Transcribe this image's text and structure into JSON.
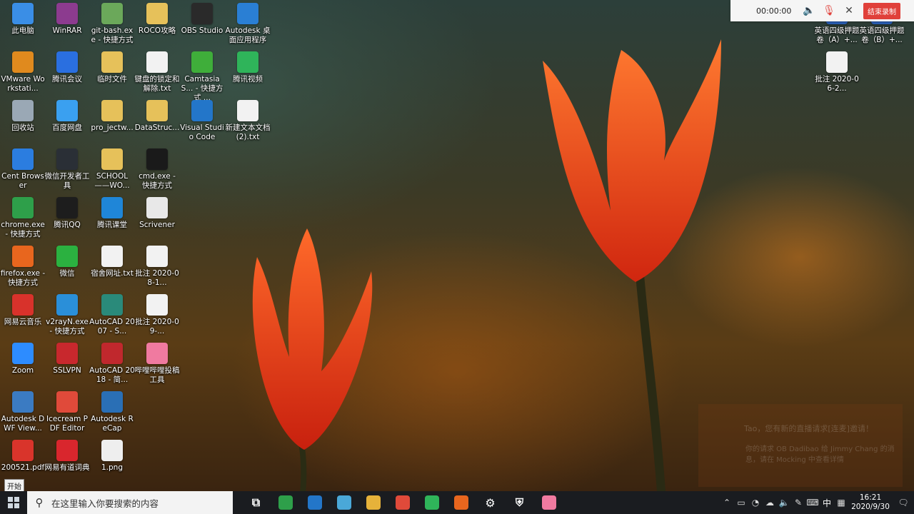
{
  "desktop_icons": [
    {
      "label": "此电脑",
      "icon": "this-pc-icon",
      "color": "#3a8ee6"
    },
    {
      "label": "VMware Workstati...",
      "icon": "vmware-icon",
      "color": "#e08a1e"
    },
    {
      "label": "回收站",
      "icon": "recycle-bin-icon",
      "color": "#9aa8b5"
    },
    {
      "label": "Cent Browser",
      "icon": "cent-browser-icon",
      "color": "#2b7de0"
    },
    {
      "label": "chrome.exe - 快捷方式",
      "icon": "chrome-icon",
      "color": "#2e9f4a"
    },
    {
      "label": "firefox.exe - 快捷方式",
      "icon": "firefox-icon",
      "color": "#e8661e"
    },
    {
      "label": "网易云音乐",
      "icon": "netease-music-icon",
      "color": "#d8322b"
    },
    {
      "label": "Zoom",
      "icon": "zoom-icon",
      "color": "#2d8cff"
    },
    {
      "label": "Autodesk DWF View...",
      "icon": "dwf-viewer-icon",
      "color": "#3b7bc2"
    },
    {
      "label": "200521.pdf",
      "icon": "pdf-file-icon",
      "color": "#d9342b"
    },
    {
      "label": "WinRAR",
      "icon": "winrar-icon",
      "color": "#8c3b8f"
    },
    {
      "label": "腾讯会议",
      "icon": "tencent-meeting-icon",
      "color": "#2a6fe0"
    },
    {
      "label": "百度网盘",
      "icon": "baidu-netdisk-icon",
      "color": "#3aa0f0"
    },
    {
      "label": "微信开发者工具",
      "icon": "wechat-devtools-icon",
      "color": "#2a2f36"
    },
    {
      "label": "腾讯QQ",
      "icon": "qq-icon",
      "color": "#1d1d1d"
    },
    {
      "label": "微信",
      "icon": "wechat-icon",
      "color": "#2bb140"
    },
    {
      "label": "v2rayN.exe - 快捷方式",
      "icon": "v2rayn-icon",
      "color": "#2a8fd9"
    },
    {
      "label": "SSLVPN",
      "icon": "sslvpn-icon",
      "color": "#c8282d"
    },
    {
      "label": "Icecream PDF Editor",
      "icon": "icecream-pdf-icon",
      "color": "#e04a3a"
    },
    {
      "label": "网易有道词典",
      "icon": "youdao-dict-icon",
      "color": "#d9262d"
    },
    {
      "label": "git-bash.exe - 快捷方式",
      "icon": "git-bash-icon",
      "color": "#6ba85a"
    },
    {
      "label": "临时文件",
      "icon": "folder-icon",
      "color": "#e6c15a"
    },
    {
      "label": "pro_jectw...",
      "icon": "folder-icon",
      "color": "#e6c15a"
    },
    {
      "label": "SCHOOL ——WO...",
      "icon": "folder-icon",
      "color": "#e6c15a"
    },
    {
      "label": "腾讯课堂",
      "icon": "tencent-classroom-icon",
      "color": "#1f86d8"
    },
    {
      "label": "宿舍网址.txt",
      "icon": "text-file-icon",
      "color": "#f2f2f2"
    },
    {
      "label": "AutoCAD 2007 - S...",
      "icon": "autocad-2007-icon",
      "color": "#2a8a7a"
    },
    {
      "label": "AutoCAD 2018 - 简...",
      "icon": "autocad-2018-icon",
      "color": "#c0282d"
    },
    {
      "label": "Autodesk ReCap",
      "icon": "recap-icon",
      "color": "#2a6fb5"
    },
    {
      "label": "1.png",
      "icon": "image-file-icon",
      "color": "#eeeeee"
    },
    {
      "label": "ROCO攻略",
      "icon": "folder-icon",
      "color": "#e6c15a"
    },
    {
      "label": "键盘的锁定和解除.txt",
      "icon": "text-file-icon",
      "color": "#f2f2f2"
    },
    {
      "label": "DataStruc...",
      "icon": "folder-icon",
      "color": "#e6c15a"
    },
    {
      "label": "cmd.exe - 快捷方式",
      "icon": "cmd-icon",
      "color": "#1a1a1a"
    },
    {
      "label": "Scrivener",
      "icon": "scrivener-icon",
      "color": "#e8e8e8"
    },
    {
      "label": "批注 2020-08-1...",
      "icon": "image-file-icon",
      "color": "#f2f2f2"
    },
    {
      "label": "批注 2020-09-...",
      "icon": "image-file-icon",
      "color": "#f2f2f2"
    },
    {
      "label": "哔哩哔哩投稿工具",
      "icon": "bilibili-upload-icon",
      "color": "#f07aa0"
    },
    {
      "label": "OBS Studio",
      "icon": "obs-icon",
      "color": "#2a2a2a"
    },
    {
      "label": "CamtasiaS... - 快捷方式 ...",
      "icon": "camtasia-icon",
      "color": "#3fae3a"
    },
    {
      "label": "Visual Studio Code",
      "icon": "vscode-icon",
      "color": "#2376c9"
    },
    {
      "label": "Autodesk 桌面应用程序",
      "icon": "autodesk-desktop-icon",
      "color": "#2a7fd4"
    },
    {
      "label": "腾讯视频",
      "icon": "tencent-video-icon",
      "color": "#2fb45a"
    },
    {
      "label": "新建文本文档 (2).txt",
      "icon": "text-file-icon",
      "color": "#f2f2f2"
    },
    {
      "label": "英语四级押题卷（A）+...",
      "icon": "word-doc-icon",
      "color": "#2b5fb5"
    },
    {
      "label": "英语四级押题卷（B）+...",
      "icon": "word-doc-icon",
      "color": "#2b5fb5"
    },
    {
      "label": "批注 2020-06-2...",
      "icon": "image-file-icon",
      "color": "#f2f2f2"
    }
  ],
  "recorder": {
    "time": "00:00:00",
    "end_label": "结束录制"
  },
  "toast": {
    "line1": "Tao，您有新的直播请求[连麦]邀请！",
    "line2": "你的请求 OB Dadibao 给 Jimmy Chang 的消息，请在 Mocking 中查看详情"
  },
  "taskbar": {
    "start_tooltip": "开始",
    "search_placeholder": "在这里输入你要搜索的内容",
    "pinned": [
      {
        "icon": "task-view-icon",
        "color": "#1a1c20"
      },
      {
        "icon": "chrome-icon",
        "color": "#2e9f4a"
      },
      {
        "icon": "vscode-icon",
        "color": "#2376c9"
      },
      {
        "icon": "cloud-app-icon",
        "color": "#4aa8d8"
      },
      {
        "icon": "file-explorer-icon",
        "color": "#e6b23a"
      },
      {
        "icon": "pdf-editor-icon",
        "color": "#e04a3a"
      },
      {
        "icon": "tencent-video-icon",
        "color": "#2fb45a"
      },
      {
        "icon": "firefox-icon",
        "color": "#e8661e"
      },
      {
        "icon": "settings-icon",
        "color": "#1a1c20"
      },
      {
        "icon": "shield-icon",
        "color": "#1a1c20"
      },
      {
        "icon": "bilibili-icon",
        "color": "#f07aa0"
      }
    ],
    "ime": "中",
    "time": "16:21",
    "date": "2020/9/30"
  }
}
